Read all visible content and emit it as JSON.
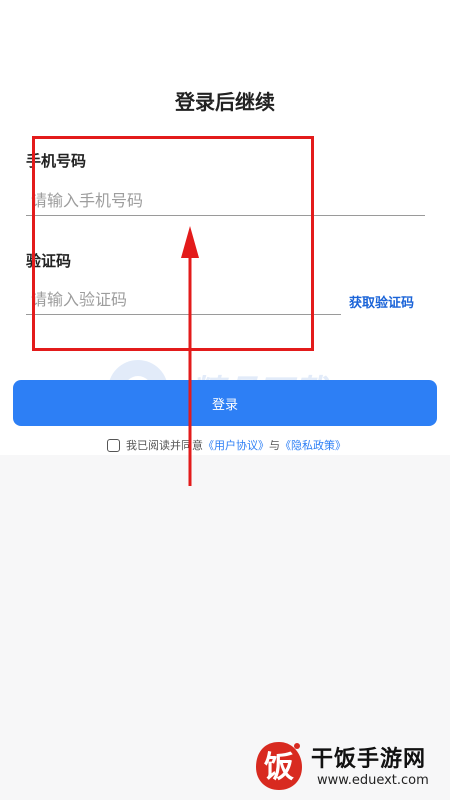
{
  "page": {
    "title": "登录后继续"
  },
  "form": {
    "phone_label": "手机号码",
    "phone_placeholder": "请输入手机号码",
    "code_label": "验证码",
    "code_placeholder": "请输入验证码",
    "get_code_label": "获取验证码",
    "login_label": "登录"
  },
  "agreement": {
    "prefix": "我已阅读并同意",
    "user_agreement": "《用户协议》",
    "conjunction": "与",
    "privacy_policy": "《隐私政策》",
    "checked": false
  },
  "watermark": {
    "center_text": "精品下载",
    "site_name": "干饭手游网",
    "site_url": "www.eduext.com",
    "logo_char": "饭"
  },
  "colors": {
    "accent": "#2d7ff5",
    "link": "#1b64d8",
    "annotation": "#e31b1b"
  }
}
